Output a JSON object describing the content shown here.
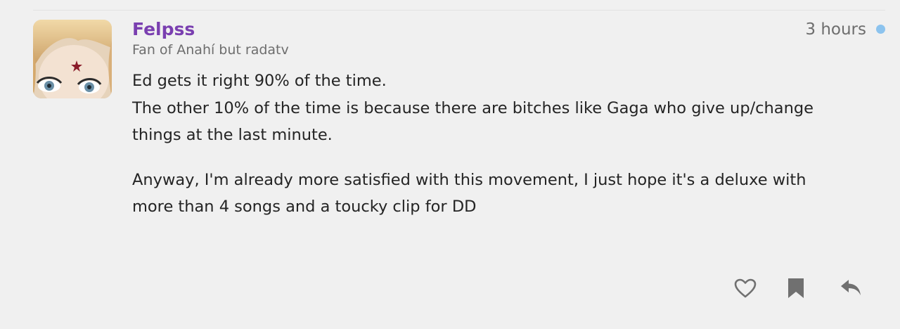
{
  "post": {
    "author": {
      "name": "Felpss",
      "title": "Fan of Anahí but radatv"
    },
    "timestamp": "3 hours",
    "paragraphs": [
      {
        "lines": [
          "Ed gets it right 90% of the time.",
          "The other 10% of the time is because there are bitches like Gaga who give up/change things at the last minute."
        ]
      },
      {
        "lines": [
          "Anyway, I'm already more satisfied with this movement, I just hope it's a deluxe with more than 4 songs and a toucky clip for DD"
        ]
      }
    ],
    "actions": {
      "like_icon": "heart-outline-icon",
      "bookmark_icon": "bookmark-icon",
      "reply_icon": "reply-arrow-icon"
    }
  },
  "colors": {
    "background": "#f0f0f0",
    "username": "#7a3fb0",
    "muted_text": "#6d6d6d",
    "unread_dot": "#8cc3ee",
    "icon": "#707070"
  }
}
